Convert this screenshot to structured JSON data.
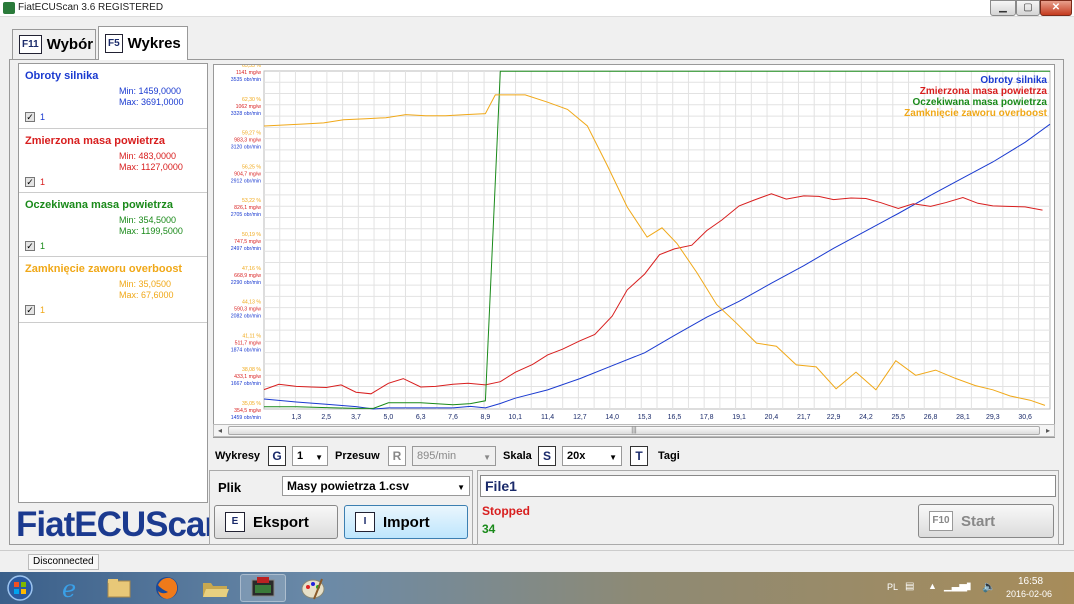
{
  "window": {
    "title": "FiatECUScan 3.6 REGISTERED"
  },
  "tabs": [
    {
      "key": "F11",
      "label": "Wybór"
    },
    {
      "key": "F5",
      "label": "Wykres"
    }
  ],
  "series": [
    {
      "name": "Obroty silnika",
      "min": "Min: 1459,0000",
      "max": "Max: 3691,0000",
      "check_label": "1",
      "color": "#1a3ad0"
    },
    {
      "name": "Zmierzona masa powietrza",
      "min": "Min: 483,0000",
      "max": "Max: 1127,0000",
      "check_label": "1",
      "color": "#d81e1e"
    },
    {
      "name": "Oczekiwana masa powietrza",
      "min": "Min: 354,5000",
      "max": "Max: 1199,5000",
      "check_label": "1",
      "color": "#1a8a1a"
    },
    {
      "name": "Zamknięcie zaworu overboost",
      "min": "Min: 35,0500",
      "max": "Max: 67,6000",
      "check_label": "1",
      "color": "#f0a818"
    }
  ],
  "logo": "FiatECUScan",
  "controls": {
    "wykresy_label": "Wykresy",
    "wykresy_key": "G",
    "wykresy_value": "1",
    "przesuw_label": "Przesuw",
    "przesuw_key": "R",
    "przesuw_value": "895/min",
    "skala_label": "Skala",
    "skala_key": "S",
    "skala_value": "20x",
    "tagi_key": "T",
    "tagi_label": "Tagi"
  },
  "file": {
    "plik_label": "Plik",
    "selected": "Masy powietrza 1.csv",
    "eksport_key": "E",
    "eksport_label": "Eksport",
    "import_key": "I",
    "import_label": "Import"
  },
  "status": {
    "file_name": "File1",
    "state": "Stopped",
    "count": "34",
    "start_key": "F10",
    "start_label": "Start"
  },
  "statusbar": {
    "connection": "Disconnected"
  },
  "tray": {
    "lang": "PL",
    "time": "16:58",
    "date": "2016-02-06"
  },
  "chart_data": {
    "type": "line",
    "x_ticks": [
      "1,3",
      "2,5",
      "3,7",
      "5,0",
      "6,3",
      "7,6",
      "8,9",
      "10,1",
      "11,4",
      "12,7",
      "14,0",
      "15,3",
      "16,5",
      "17,8",
      "19,1",
      "20,4",
      "21,7",
      "22,9",
      "24,2",
      "25,5",
      "26,8",
      "28,1",
      "29,3",
      "30,6"
    ],
    "xlim": [
      0,
      31.6
    ],
    "y_ticks": [
      [
        "65,33 %",
        "1141 mg/w",
        "3535 obr/min"
      ],
      [
        "62,30 %",
        "1062 mg/w",
        "3328 obr/min"
      ],
      [
        "59,27 %",
        "983,3 mg/w",
        "3120 obr/min"
      ],
      [
        "56,25 %",
        "904,7 mg/w",
        "2912 obr/min"
      ],
      [
        "53,22 %",
        "826,1 mg/w",
        "2705 obr/min"
      ],
      [
        "50,19 %",
        "747,5 mg/w",
        "2497 obr/min"
      ],
      [
        "47,16 %",
        "668,9 mg/w",
        "2290 obr/min"
      ],
      [
        "44,13 %",
        "590,3 mg/w",
        "2082 obr/min"
      ],
      [
        "41,11 %",
        "511,7 mg/w",
        "1874 obr/min"
      ],
      [
        "38,08 %",
        "433,1 mg/w",
        "1667 obr/min"
      ],
      [
        "35,05 %",
        "354,5 mg/w",
        "1459 obr/min"
      ]
    ],
    "legend": [
      "Obroty silnika",
      "Zmierzona masa powietrza",
      "Oczekiwana masa powietrza",
      "Zamknięcie zaworu overboost"
    ],
    "legend_position": "top-right",
    "grid": true,
    "series": [
      {
        "name": "Obroty silnika",
        "color": "#1a3ad0",
        "unit": "obr/min",
        "ylim": [
          1459,
          3691
        ],
        "x": [
          0,
          1.3,
          2.5,
          3.7,
          4.4,
          5.0,
          6.3,
          7.6,
          8.3,
          8.9,
          9.5,
          10.1,
          11.4,
          12.7,
          14.0,
          15.3,
          16.5,
          17.8,
          19.1,
          20.4,
          21.7,
          22.9,
          24.2,
          25.5,
          26.8,
          28.1,
          29.3,
          30.6,
          31.6
        ],
        "values": [
          1525,
          1505,
          1490,
          1475,
          1459,
          1466,
          1466,
          1466,
          1476,
          1466,
          1495,
          1530,
          1585,
          1660,
          1745,
          1830,
          1945,
          2065,
          2170,
          2290,
          2405,
          2520,
          2635,
          2750,
          2870,
          2985,
          3090,
          3220,
          3340
        ]
      },
      {
        "name": "Zmierzona masa powietrza",
        "color": "#d81e1e",
        "unit": "mg/w",
        "ylim": [
          483,
          1127
        ],
        "x": [
          0,
          0.6,
          1.3,
          1.9,
          2.5,
          3.1,
          3.7,
          4.3,
          5.0,
          5.6,
          6.3,
          6.9,
          7.6,
          8.2,
          8.9,
          9.5,
          10.1,
          10.8,
          11.4,
          12.0,
          12.7,
          13.3,
          14.0,
          14.6,
          15.3,
          15.9,
          16.5,
          17.2,
          17.8,
          18.4,
          19.1,
          19.7,
          20.4,
          21.0,
          21.7,
          22.3,
          22.9,
          23.6,
          24.2,
          24.8,
          25.5,
          26.1,
          26.8,
          27.4,
          28.1,
          28.7,
          29.3,
          29.9,
          30.6,
          31.3
        ],
        "values": [
          520,
          530,
          526,
          525,
          524,
          529,
          515,
          512,
          532,
          541,
          525,
          526,
          530,
          532,
          529,
          535,
          553,
          568,
          586,
          597,
          613,
          625,
          660,
          710,
          740,
          777,
          788,
          795,
          823,
          843,
          870,
          881,
          893,
          883,
          889,
          888,
          882,
          885,
          884,
          876,
          865,
          874,
          869,
          876,
          886,
          875,
          870,
          869,
          868,
          862
        ]
      },
      {
        "name": "Oczekiwana masa powietrza",
        "color": "#1a8a1a",
        "unit": "mg/w",
        "ylim": [
          354.5,
          1199.5
        ],
        "x": [
          0,
          1.3,
          2.5,
          3.7,
          4.4,
          5.0,
          6.3,
          7.6,
          8.3,
          8.9,
          9.5,
          10.1,
          12.7,
          15.3,
          17.8,
          20.4,
          22.9,
          25.5,
          28.1,
          30.6,
          31.6
        ],
        "values": [
          360,
          360,
          358,
          356,
          356,
          370,
          370,
          365,
          368,
          375,
          1199,
          1199,
          1199,
          1199,
          1199,
          1199,
          1199,
          1199,
          1199,
          1199,
          1199
        ]
      },
      {
        "name": "Zamknięcie zaworu overboost",
        "color": "#f0a818",
        "unit": "%",
        "ylim": [
          35.05,
          67.6
        ],
        "x": [
          0,
          0.8,
          1.6,
          2.4,
          3.2,
          4.1,
          4.9,
          5.7,
          6.5,
          7.3,
          8.1,
          8.9,
          9.3,
          9.7,
          10.5,
          11.4,
          12.2,
          13.0,
          13.8,
          14.6,
          15.4,
          16.0,
          16.6,
          17.4,
          18.2,
          19.0,
          19.8,
          20.6,
          21.4,
          22.2,
          23.0,
          23.8,
          24.6,
          25.4,
          26.2,
          27.0,
          27.8,
          28.6,
          29.3,
          30.0,
          30.8,
          31.4
        ],
        "values": [
          62.3,
          62.4,
          62.5,
          62.6,
          62.9,
          63.0,
          63.1,
          63.4,
          63.3,
          63.3,
          63.4,
          63.5,
          65.3,
          65.3,
          65.3,
          64.6,
          63.9,
          62.3,
          58.5,
          54.5,
          51.6,
          52.5,
          51.0,
          48.2,
          45.1,
          43.3,
          41.4,
          41.1,
          39.3,
          39.1,
          37.0,
          38.6,
          36.9,
          39.7,
          38.3,
          38.8,
          38.0,
          37.3,
          36.9,
          36.3,
          35.9,
          35.4
        ]
      }
    ]
  }
}
